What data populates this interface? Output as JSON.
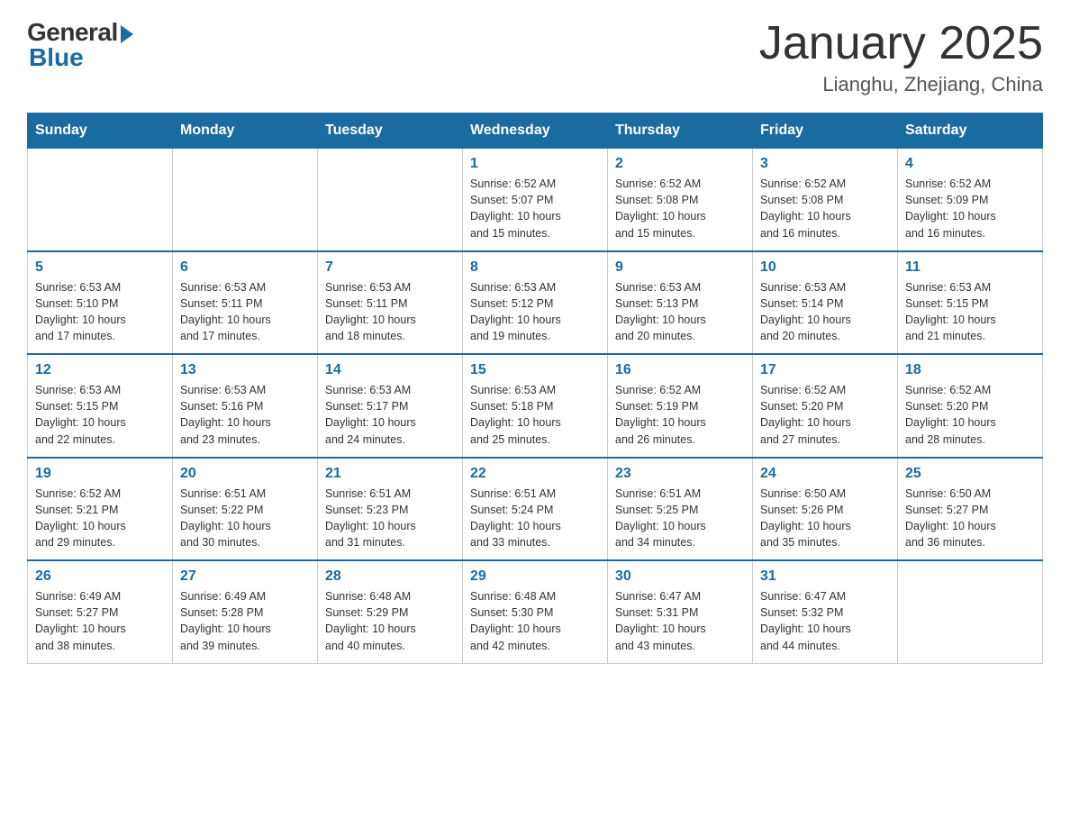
{
  "header": {
    "logo_general": "General",
    "logo_blue": "Blue",
    "month_title": "January 2025",
    "location": "Lianghu, Zhejiang, China"
  },
  "days_of_week": [
    "Sunday",
    "Monday",
    "Tuesday",
    "Wednesday",
    "Thursday",
    "Friday",
    "Saturday"
  ],
  "weeks": [
    [
      {
        "day": "",
        "info": ""
      },
      {
        "day": "",
        "info": ""
      },
      {
        "day": "",
        "info": ""
      },
      {
        "day": "1",
        "info": "Sunrise: 6:52 AM\nSunset: 5:07 PM\nDaylight: 10 hours\nand 15 minutes."
      },
      {
        "day": "2",
        "info": "Sunrise: 6:52 AM\nSunset: 5:08 PM\nDaylight: 10 hours\nand 15 minutes."
      },
      {
        "day": "3",
        "info": "Sunrise: 6:52 AM\nSunset: 5:08 PM\nDaylight: 10 hours\nand 16 minutes."
      },
      {
        "day": "4",
        "info": "Sunrise: 6:52 AM\nSunset: 5:09 PM\nDaylight: 10 hours\nand 16 minutes."
      }
    ],
    [
      {
        "day": "5",
        "info": "Sunrise: 6:53 AM\nSunset: 5:10 PM\nDaylight: 10 hours\nand 17 minutes."
      },
      {
        "day": "6",
        "info": "Sunrise: 6:53 AM\nSunset: 5:11 PM\nDaylight: 10 hours\nand 17 minutes."
      },
      {
        "day": "7",
        "info": "Sunrise: 6:53 AM\nSunset: 5:11 PM\nDaylight: 10 hours\nand 18 minutes."
      },
      {
        "day": "8",
        "info": "Sunrise: 6:53 AM\nSunset: 5:12 PM\nDaylight: 10 hours\nand 19 minutes."
      },
      {
        "day": "9",
        "info": "Sunrise: 6:53 AM\nSunset: 5:13 PM\nDaylight: 10 hours\nand 20 minutes."
      },
      {
        "day": "10",
        "info": "Sunrise: 6:53 AM\nSunset: 5:14 PM\nDaylight: 10 hours\nand 20 minutes."
      },
      {
        "day": "11",
        "info": "Sunrise: 6:53 AM\nSunset: 5:15 PM\nDaylight: 10 hours\nand 21 minutes."
      }
    ],
    [
      {
        "day": "12",
        "info": "Sunrise: 6:53 AM\nSunset: 5:15 PM\nDaylight: 10 hours\nand 22 minutes."
      },
      {
        "day": "13",
        "info": "Sunrise: 6:53 AM\nSunset: 5:16 PM\nDaylight: 10 hours\nand 23 minutes."
      },
      {
        "day": "14",
        "info": "Sunrise: 6:53 AM\nSunset: 5:17 PM\nDaylight: 10 hours\nand 24 minutes."
      },
      {
        "day": "15",
        "info": "Sunrise: 6:53 AM\nSunset: 5:18 PM\nDaylight: 10 hours\nand 25 minutes."
      },
      {
        "day": "16",
        "info": "Sunrise: 6:52 AM\nSunset: 5:19 PM\nDaylight: 10 hours\nand 26 minutes."
      },
      {
        "day": "17",
        "info": "Sunrise: 6:52 AM\nSunset: 5:20 PM\nDaylight: 10 hours\nand 27 minutes."
      },
      {
        "day": "18",
        "info": "Sunrise: 6:52 AM\nSunset: 5:20 PM\nDaylight: 10 hours\nand 28 minutes."
      }
    ],
    [
      {
        "day": "19",
        "info": "Sunrise: 6:52 AM\nSunset: 5:21 PM\nDaylight: 10 hours\nand 29 minutes."
      },
      {
        "day": "20",
        "info": "Sunrise: 6:51 AM\nSunset: 5:22 PM\nDaylight: 10 hours\nand 30 minutes."
      },
      {
        "day": "21",
        "info": "Sunrise: 6:51 AM\nSunset: 5:23 PM\nDaylight: 10 hours\nand 31 minutes."
      },
      {
        "day": "22",
        "info": "Sunrise: 6:51 AM\nSunset: 5:24 PM\nDaylight: 10 hours\nand 33 minutes."
      },
      {
        "day": "23",
        "info": "Sunrise: 6:51 AM\nSunset: 5:25 PM\nDaylight: 10 hours\nand 34 minutes."
      },
      {
        "day": "24",
        "info": "Sunrise: 6:50 AM\nSunset: 5:26 PM\nDaylight: 10 hours\nand 35 minutes."
      },
      {
        "day": "25",
        "info": "Sunrise: 6:50 AM\nSunset: 5:27 PM\nDaylight: 10 hours\nand 36 minutes."
      }
    ],
    [
      {
        "day": "26",
        "info": "Sunrise: 6:49 AM\nSunset: 5:27 PM\nDaylight: 10 hours\nand 38 minutes."
      },
      {
        "day": "27",
        "info": "Sunrise: 6:49 AM\nSunset: 5:28 PM\nDaylight: 10 hours\nand 39 minutes."
      },
      {
        "day": "28",
        "info": "Sunrise: 6:48 AM\nSunset: 5:29 PM\nDaylight: 10 hours\nand 40 minutes."
      },
      {
        "day": "29",
        "info": "Sunrise: 6:48 AM\nSunset: 5:30 PM\nDaylight: 10 hours\nand 42 minutes."
      },
      {
        "day": "30",
        "info": "Sunrise: 6:47 AM\nSunset: 5:31 PM\nDaylight: 10 hours\nand 43 minutes."
      },
      {
        "day": "31",
        "info": "Sunrise: 6:47 AM\nSunset: 5:32 PM\nDaylight: 10 hours\nand 44 minutes."
      },
      {
        "day": "",
        "info": ""
      }
    ]
  ]
}
